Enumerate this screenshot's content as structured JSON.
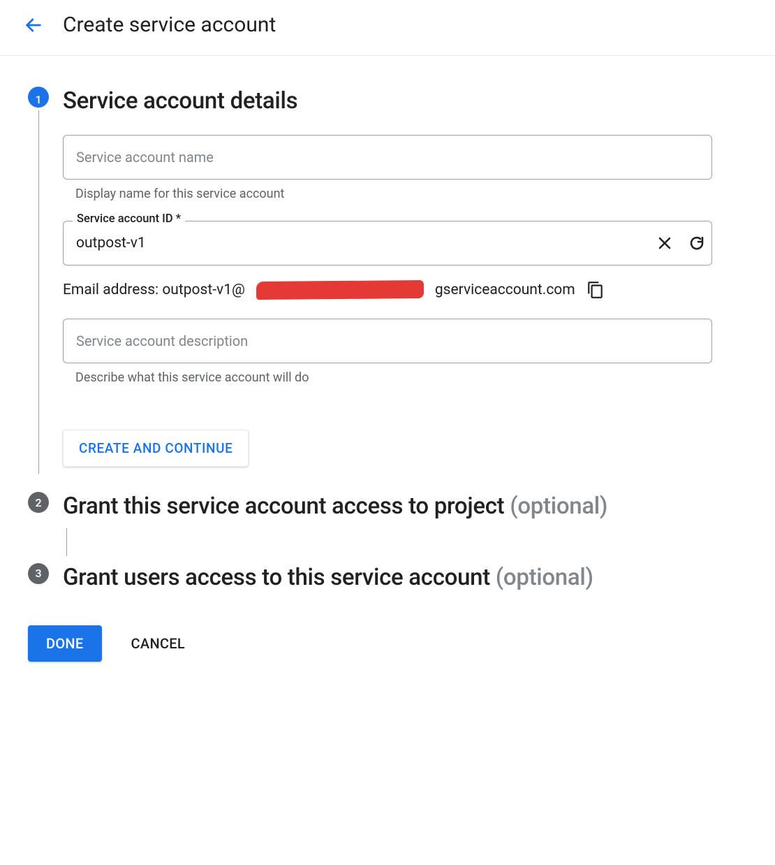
{
  "header": {
    "title": "Create service account"
  },
  "steps": {
    "s1": {
      "num": "1",
      "title": "Service account details",
      "name_placeholder": "Service account name",
      "name_value": "",
      "name_help": "Display name for this service account",
      "id_label": "Service account ID *",
      "id_value": "outpost-v1",
      "email_prefix": "Email address: outpost-v1@",
      "email_suffix": "gserviceaccount.com",
      "desc_placeholder": "Service account description",
      "desc_value": "",
      "desc_help": "Describe what this service account will do",
      "cta": "CREATE AND CONTINUE"
    },
    "s2": {
      "num": "2",
      "title": "Grant this service account access to project",
      "optional": " (optional)"
    },
    "s3": {
      "num": "3",
      "title": "Grant users access to this service account",
      "optional": " (optional)"
    }
  },
  "footer": {
    "done": "DONE",
    "cancel": "CANCEL"
  }
}
